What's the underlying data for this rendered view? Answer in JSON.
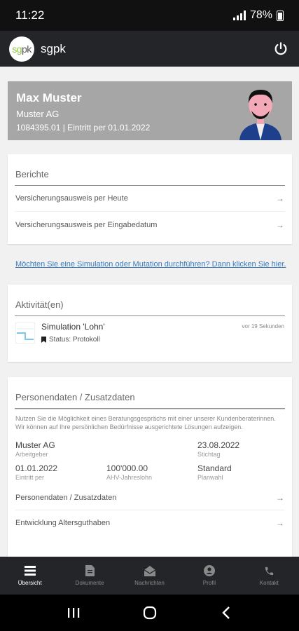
{
  "status_bar": {
    "time": "11:22",
    "battery": "78%"
  },
  "header": {
    "logo_sg": "sg",
    "logo_pk": "pk",
    "app_name": "sgpk"
  },
  "profile": {
    "name": "Max Muster",
    "company": "Muster AG",
    "meta": "1084395.01 | Eintritt per 01.01.2022"
  },
  "reports": {
    "title": "Berichte",
    "items": [
      {
        "label": "Versicherungsausweis per Heute"
      },
      {
        "label": "Versicherungsausweis per Eingabedatum"
      }
    ]
  },
  "simulation_link": "Möchten Sie eine Simulation oder Mutation durchführen? Dann klicken Sie hier.",
  "activities": {
    "title": "Aktivität(en)",
    "items": [
      {
        "title": "Simulation 'Lohn'",
        "status": "Status: Protokoll",
        "time": "vor 19 Sekunden"
      }
    ]
  },
  "personal": {
    "title": "Personendaten / Zusatzdaten",
    "description": "Nutzen Sie die Möglichkeit eines Beratungsgesprächs mit einer unserer Kundenberaterinnen. Wir können auf Ihre persönlichen Bedürfnisse ausgerichtete Lösungen aufzeigen.",
    "fields": [
      {
        "value": "Muster AG",
        "label": "Arbeitgeber"
      },
      {
        "value": "",
        "label": ""
      },
      {
        "value": "23.08.2022",
        "label": "Stichtag"
      },
      {
        "value": "01.01.2022",
        "label": "Eintritt per"
      },
      {
        "value": "100'000.00",
        "label": "AHV-Jahreslohn"
      },
      {
        "value": "Standard",
        "label": "Planwahl"
      }
    ],
    "links": [
      {
        "label": "Personendaten / Zusatzdaten"
      },
      {
        "label": "Entwicklung Altersguthaben"
      }
    ]
  },
  "bottom_nav": [
    {
      "label": "Übersicht",
      "icon": "overview-icon"
    },
    {
      "label": "Dokumente",
      "icon": "document-icon"
    },
    {
      "label": "Nachrichten",
      "icon": "mail-icon"
    },
    {
      "label": "Profil",
      "icon": "profile-icon"
    },
    {
      "label": "Kontakt",
      "icon": "phone-icon"
    }
  ],
  "colors": {
    "header": "#232528",
    "profile_bg": "#a6a6a6",
    "link": "#3a7bbf",
    "logo_green": "#8dc63f"
  }
}
